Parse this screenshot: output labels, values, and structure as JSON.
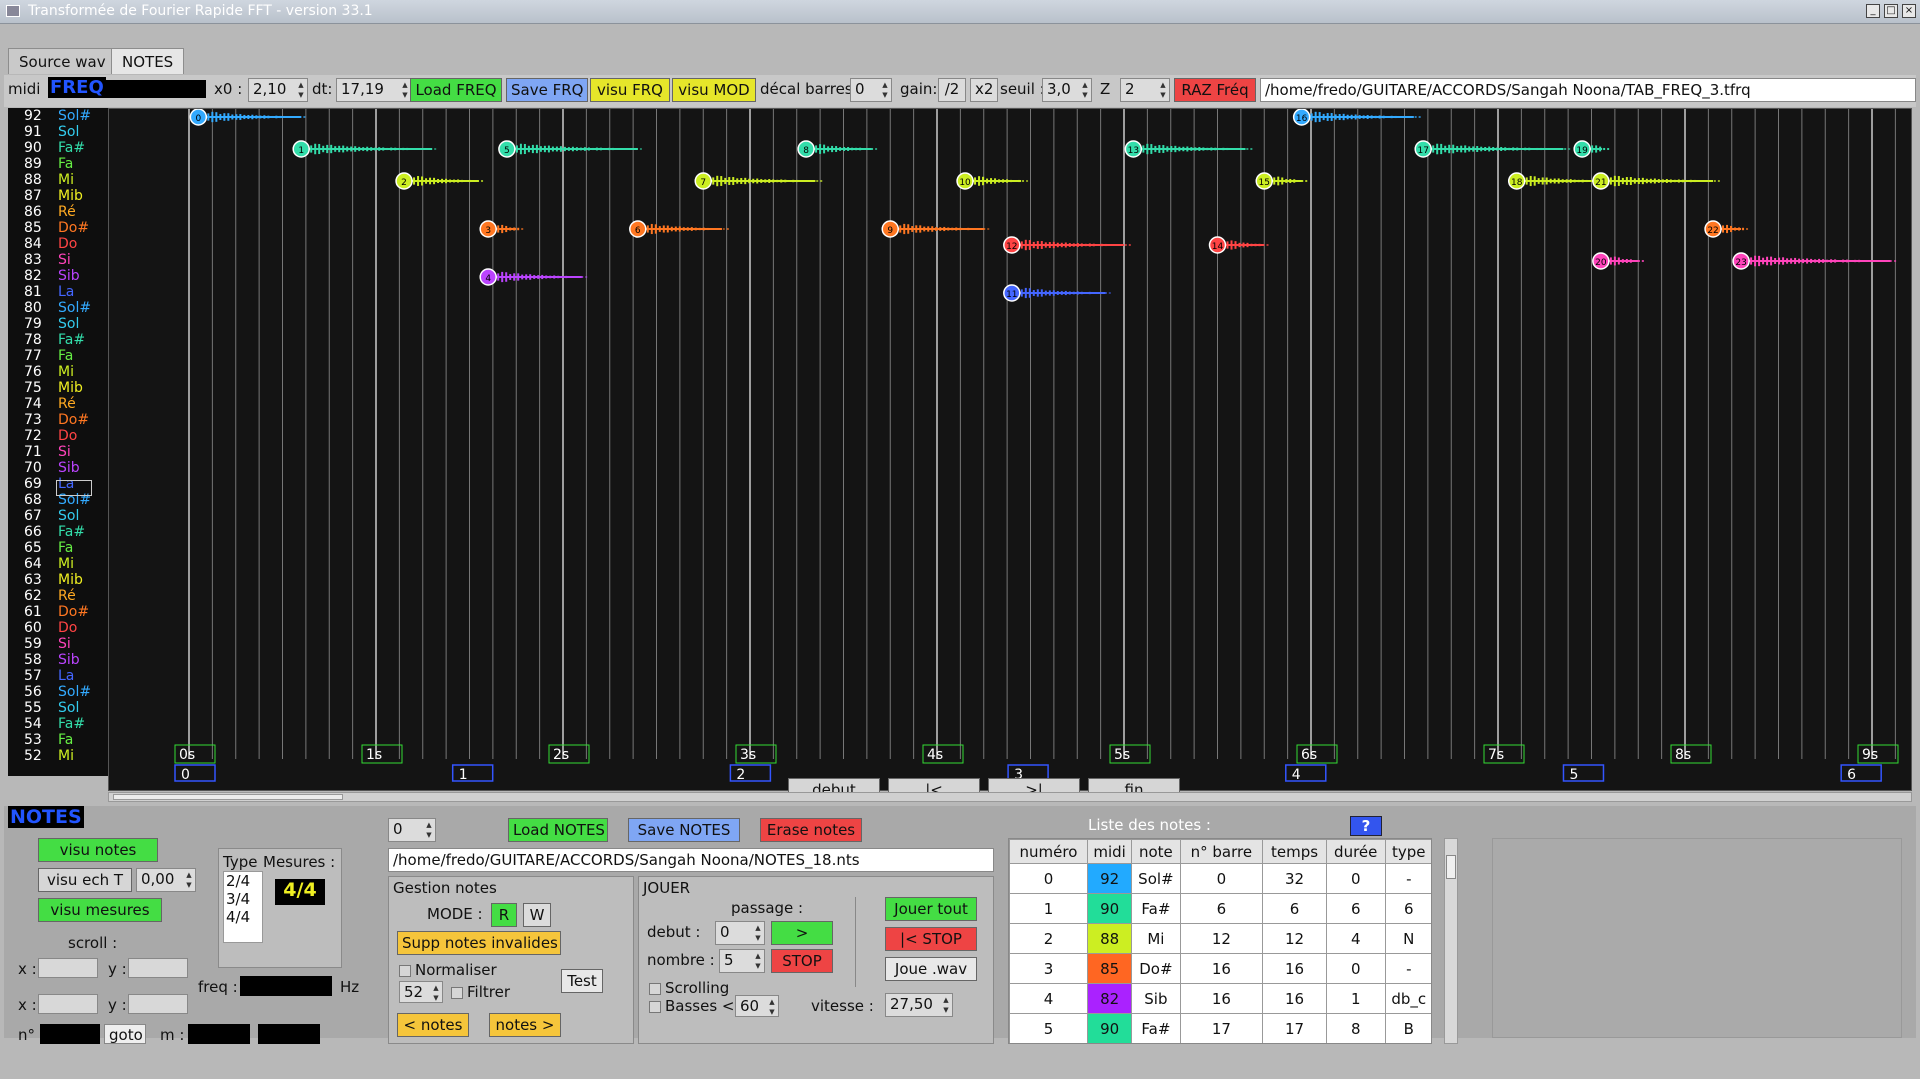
{
  "window": {
    "title": "Transformée de Fourier Rapide FFT - version 33.1"
  },
  "tabs": [
    "Source wav",
    "NOTES"
  ],
  "toolbar": {
    "midi": "midi",
    "freq": "FREQ",
    "x0_label": "x0 :",
    "x0": "2,10",
    "dt_label": "dt:",
    "dt": "17,19",
    "load_freq": "Load FREQ",
    "save_frq": "Save FRQ",
    "visu_frq": "visu FRQ",
    "visu_mod": "visu MOD",
    "decal_label": "décal barres:",
    "decal": "0",
    "gain_label": "gain:",
    "div2": "/2",
    "x2": "x2",
    "seuil_label": "seuil :",
    "seuil": "3,0",
    "z_label": "Z",
    "z": "2",
    "raz": "RAZ Fréq",
    "path": "/home/fredo/GUITARE/ACCORDS/Sangah Noona/TAB_FREQ_3.tfrq"
  },
  "pitch_rows": [
    {
      "n": "92",
      "t": "Sol#",
      "c": "#33aaff"
    },
    {
      "n": "91",
      "t": "Sol",
      "c": "#33ccee"
    },
    {
      "n": "90",
      "t": "Fa#",
      "c": "#33ddaa"
    },
    {
      "n": "89",
      "t": "Fa",
      "c": "#66ee44"
    },
    {
      "n": "88",
      "t": "Mi",
      "c": "#ccee22"
    },
    {
      "n": "87",
      "t": "Mib",
      "c": "#eeee22"
    },
    {
      "n": "86",
      "t": "Ré",
      "c": "#ffaa22"
    },
    {
      "n": "85",
      "t": "Do#",
      "c": "#ff7722"
    },
    {
      "n": "84",
      "t": "Do",
      "c": "#ff4444"
    },
    {
      "n": "83",
      "t": "Si",
      "c": "#ff44bb"
    },
    {
      "n": "82",
      "t": "Sib",
      "c": "#bb44ff"
    },
    {
      "n": "81",
      "t": "La",
      "c": "#4466ff"
    },
    {
      "n": "80",
      "t": "Sol#",
      "c": "#33aaff"
    },
    {
      "n": "79",
      "t": "Sol",
      "c": "#33ccee"
    },
    {
      "n": "78",
      "t": "Fa#",
      "c": "#33ddaa"
    },
    {
      "n": "77",
      "t": "Fa",
      "c": "#66ee44"
    },
    {
      "n": "76",
      "t": "Mi",
      "c": "#ccee22"
    },
    {
      "n": "75",
      "t": "Mib",
      "c": "#eeee22"
    },
    {
      "n": "74",
      "t": "Ré",
      "c": "#ffaa22"
    },
    {
      "n": "73",
      "t": "Do#",
      "c": "#ff7722"
    },
    {
      "n": "72",
      "t": "Do",
      "c": "#ff4444"
    },
    {
      "n": "71",
      "t": "Si",
      "c": "#ff44bb"
    },
    {
      "n": "70",
      "t": "Sib",
      "c": "#bb44ff"
    },
    {
      "n": "69",
      "t": "La",
      "c": "#4466ff"
    },
    {
      "n": "68",
      "t": "Sol#",
      "c": "#33aaff"
    },
    {
      "n": "67",
      "t": "Sol",
      "c": "#33ccee"
    },
    {
      "n": "66",
      "t": "Fa#",
      "c": "#33ddaa"
    },
    {
      "n": "65",
      "t": "Fa",
      "c": "#66ee44"
    },
    {
      "n": "64",
      "t": "Mi",
      "c": "#ccee22"
    },
    {
      "n": "63",
      "t": "Mib",
      "c": "#eeee22"
    },
    {
      "n": "62",
      "t": "Ré",
      "c": "#ffaa22"
    },
    {
      "n": "61",
      "t": "Do#",
      "c": "#ff7722"
    },
    {
      "n": "60",
      "t": "Do",
      "c": "#ff4444"
    },
    {
      "n": "59",
      "t": "Si",
      "c": "#ff44bb"
    },
    {
      "n": "58",
      "t": "Sib",
      "c": "#bb44ff"
    },
    {
      "n": "57",
      "t": "La",
      "c": "#4466ff"
    },
    {
      "n": "56",
      "t": "Sol#",
      "c": "#33aaff"
    },
    {
      "n": "55",
      "t": "Sol",
      "c": "#33ccee"
    },
    {
      "n": "54",
      "t": "Fa#",
      "c": "#33ddaa"
    },
    {
      "n": "53",
      "t": "Fa",
      "c": "#66ee44"
    },
    {
      "n": "52",
      "t": "Mi",
      "c": "#ccee22"
    }
  ],
  "time_labels": [
    "0s",
    "1s",
    "2s",
    "3s",
    "4s",
    "5s",
    "6s",
    "7s",
    "8s",
    "9s"
  ],
  "bar_labels": [
    "0",
    "1",
    "2",
    "3",
    "4",
    "5",
    "6"
  ],
  "note_markers": [
    {
      "id": "0",
      "midi": 92,
      "t": 0.05,
      "d": 0.55
    },
    {
      "id": "1",
      "midi": 90,
      "t": 0.6,
      "d": 0.7
    },
    {
      "id": "2",
      "midi": 88,
      "t": 1.15,
      "d": 0.4
    },
    {
      "id": "3",
      "midi": 85,
      "t": 1.6,
      "d": 0.15
    },
    {
      "id": "4",
      "midi": 82,
      "t": 1.6,
      "d": 0.5
    },
    {
      "id": "5",
      "midi": 90,
      "t": 1.7,
      "d": 0.7
    },
    {
      "id": "6",
      "midi": 85,
      "t": 2.4,
      "d": 0.45
    },
    {
      "id": "7",
      "midi": 88,
      "t": 2.75,
      "d": 0.6
    },
    {
      "id": "8",
      "midi": 90,
      "t": 3.3,
      "d": 0.35
    },
    {
      "id": "9",
      "midi": 85,
      "t": 3.75,
      "d": 0.5
    },
    {
      "id": "10",
      "midi": 88,
      "t": 4.15,
      "d": 0.3
    },
    {
      "id": "11",
      "midi": 81,
      "t": 4.4,
      "d": 0.5
    },
    {
      "id": "12",
      "midi": 84,
      "t": 4.4,
      "d": 0.6
    },
    {
      "id": "13",
      "midi": 90,
      "t": 5.05,
      "d": 0.6
    },
    {
      "id": "14",
      "midi": 84,
      "t": 5.5,
      "d": 0.25
    },
    {
      "id": "15",
      "midi": 88,
      "t": 5.75,
      "d": 0.2
    },
    {
      "id": "16",
      "midi": 92,
      "t": 5.95,
      "d": 0.6
    },
    {
      "id": "17",
      "midi": 90,
      "t": 6.6,
      "d": 0.75
    },
    {
      "id": "18",
      "midi": 88,
      "t": 7.1,
      "d": 0.45
    },
    {
      "id": "19",
      "midi": 90,
      "t": 7.45,
      "d": 0.1
    },
    {
      "id": "20",
      "midi": 83,
      "t": 7.55,
      "d": 0.2
    },
    {
      "id": "21",
      "midi": 88,
      "t": 7.55,
      "d": 0.6
    },
    {
      "id": "22",
      "midi": 85,
      "t": 8.15,
      "d": 0.15
    },
    {
      "id": "23",
      "midi": 83,
      "t": 8.3,
      "d": 0.8
    }
  ],
  "nav": {
    "debut": "debut",
    "prev": "|<",
    "next": ">|",
    "fin": "fin"
  },
  "left": {
    "title": "NOTES",
    "visu_notes": "visu notes",
    "visu_ech": "visu ech T",
    "ech_val": "0,00",
    "visu_mesures": "visu mesures",
    "scroll": "scroll :",
    "x": "x :",
    "y": "y :",
    "n": "n°",
    "goto": "goto",
    "m": "m :",
    "freq": "freq :",
    "hz": "Hz",
    "type": "Type",
    "mesures": "Mesures :",
    "types": [
      "2/4",
      "3/4",
      "4/4"
    ],
    "current": "4/4"
  },
  "center": {
    "spin0": "0",
    "load_notes": "Load NOTES",
    "save_notes": "Save NOTES",
    "erase_notes": "Erase notes",
    "path": "/home/fredo/GUITARE/ACCORDS/Sangah Noona/NOTES_18.nts",
    "gestion": "Gestion notes",
    "mode": "MODE :",
    "r": "R",
    "w": "W",
    "supp": "Supp notes invalides",
    "normaliser": "Normaliser",
    "n52": "52",
    "filtrer": "Filtrer",
    "test": "Test",
    "prev_notes": "< notes",
    "next_notes": "notes >",
    "jouer": "JOUER",
    "passage": "passage :",
    "debut_label": "debut :",
    "debut": "0",
    "nombre_label": "nombre :",
    "nombre": "5",
    "go": ">",
    "stop": "STOP",
    "jouer_tout": "Jouer tout",
    "stop2": "|< STOP",
    "joue_wav": "Joue .wav",
    "scrolling": "Scrolling",
    "basses": "Basses <",
    "basses_val": "60",
    "vitesse_label": "vitesse :",
    "vitesse": "27,50"
  },
  "list": {
    "title": "Liste des notes :",
    "help": "?",
    "headers": [
      "numéro",
      "midi",
      "note",
      "n° barre",
      "temps",
      "durée",
      "type"
    ],
    "rows": [
      {
        "num": "0",
        "midi": "92",
        "color": "#22aaff",
        "note": "Sol#",
        "barre": "0",
        "temps": "32",
        "duree": "0",
        "type": "-"
      },
      {
        "num": "1",
        "midi": "90",
        "color": "#22dd99",
        "note": "Fa#",
        "barre": "6",
        "temps": "6",
        "duree": "6",
        "type": "6"
      },
      {
        "num": "2",
        "midi": "88",
        "color": "#ccee22",
        "note": "Mi",
        "barre": "12",
        "temps": "12",
        "duree": "4",
        "type": "N"
      },
      {
        "num": "3",
        "midi": "85",
        "color": "#ff6622",
        "note": "Do#",
        "barre": "16",
        "temps": "16",
        "duree": "0",
        "type": "-"
      },
      {
        "num": "4",
        "midi": "82",
        "color": "#aa22ff",
        "note": "Sib",
        "barre": "16",
        "temps": "16",
        "duree": "1",
        "type": "db_c"
      },
      {
        "num": "5",
        "midi": "90",
        "color": "#22dd99",
        "note": "Fa#",
        "barre": "17",
        "temps": "17",
        "duree": "8",
        "type": "B"
      }
    ]
  }
}
